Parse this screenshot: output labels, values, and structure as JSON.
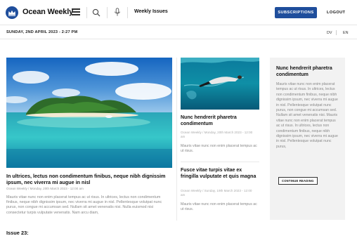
{
  "header": {
    "brand": "Ocean Weekly",
    "nav_link": "Weekly Issues",
    "subscribe_label": "SUBSCRIPTIONS",
    "logout_label": "LOGOUT",
    "brand_color": "#1f4e9c"
  },
  "datebar": {
    "date": "SUNDAY, 2ND APRIL 2023 - 2:27 PM",
    "lang_dv": "DV",
    "lang_en": "EN"
  },
  "feature": {
    "title": "In ultrices, lectus non condimentum finibus, neque nibh dignissim ipsum, nec viverra mi augue in nisl",
    "meta": "Ocean Weekly / Monday, 20th March 2023 - 12:00 am",
    "body": "Mauris vitae nunc non enim placerat tempus ac ut risus. In ultrices, lectus non condimentum finibus, neque nibh dignissim ipsum, nec viverra mi augue in nisl. Pellentesque volutpat nunc purus, non congue mi accumsan sed. Nullam sit amet venenatis nisi. Nulla euismod nisi consectetur turpis vulputate venenatis. Nam arcu diam,"
  },
  "middle": [
    {
      "title": "Nunc hendrerit pharetra condimentum",
      "meta": "Ocean Weekly / Monday, 20th March 2023 - 12:00 am",
      "body": "Mauris vitae nunc non enim placerat tempus ac ut risus."
    },
    {
      "title": "Fusce vitae turpis vitae ex fringilla vulputate et quis magna",
      "meta": "Ocean Weekly / Sunday, 19th March 2023 - 12:00 am",
      "body": "Mauris vitae nunc non enim placerat tempus ac ut risus."
    }
  ],
  "card": {
    "title": "Nunc hendrerit pharetra condimentum",
    "body": "Mauris vitae nunc non enim placerat tempus ac ut risus. In ultrices, lectus non condimentum finibus, neque nibh dignissim ipsum, nec viverra mi augue in nisl. Pellentesque volutpat nunc purus, non congue mi accumsan sed. Nullam sit amet venenatis nisi. Mauris vitae nunc non enim placerat tempus ac ut risus. In ultrices, lectus non condimentum finibus, neque nibh dignissim ipsum, nec viverra mi augue in nisl. Pellentesque volutpat nunc purus,",
    "button_label": "CONTINUE READING"
  },
  "issue_heading": "Issue 23:"
}
